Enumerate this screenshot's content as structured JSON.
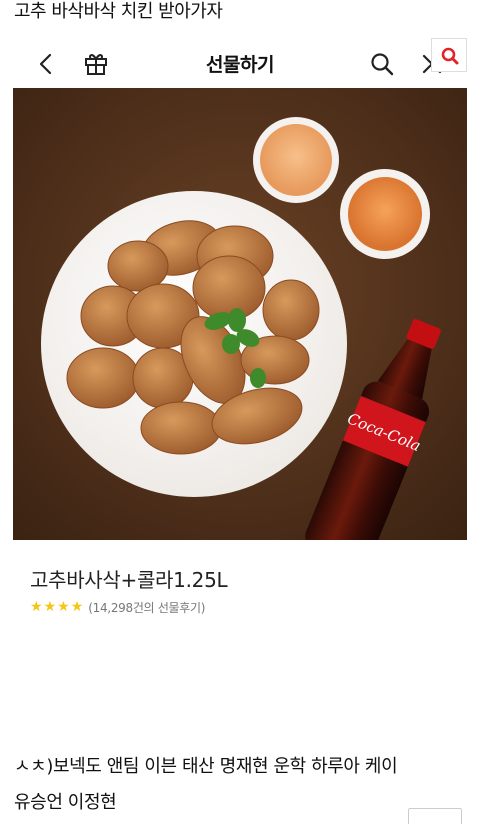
{
  "post": {
    "title": "고추 바삭바삭 치킨 받아가자",
    "caption_line1": "ㅅㅊ)보넥도 앤팀 이븐 태산 명재현 운학 하루아 케이",
    "caption_line2": "유승언 이정현"
  },
  "nav": {
    "title": "선물하기",
    "icons": [
      "back-icon",
      "gift-icon",
      "search-icon",
      "close-icon"
    ]
  },
  "overlay": {
    "icon": "search-icon",
    "accent": "#e2232a"
  },
  "product": {
    "name": "고추바사삭+콜라1.25L",
    "stars": 4,
    "review_count": "(14,298건의 선물후기)",
    "star_color": "#f5c518"
  }
}
